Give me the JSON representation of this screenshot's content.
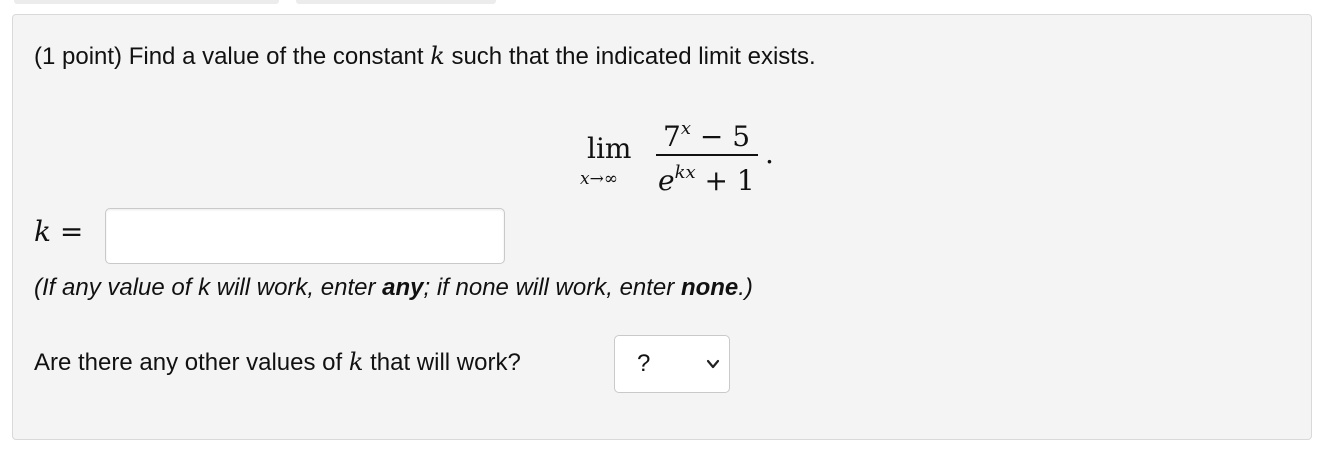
{
  "problem": {
    "intro_prefix": "(1 point) Find a value of the constant ",
    "k_var": "k",
    "intro_suffix": " such that the indicated limit exists.",
    "formula": {
      "lim": "lim",
      "lim_sub": "x→∞",
      "num_base": "7",
      "num_exp": "x",
      "num_rest": " − 5",
      "den_base": "e",
      "den_exp": "kx",
      "den_rest": " + 1",
      "period": "."
    },
    "answer_label_var": "k",
    "answer_label_eq": " =",
    "answer_value": "",
    "answer_placeholder": "",
    "hint": {
      "part1": "(If any value of k will work, enter ",
      "any": "any",
      "part2": "; if none will work, enter ",
      "none": "none",
      "part3": ".)"
    },
    "question_prefix": "Are there any other values of ",
    "question_var": "k",
    "question_suffix": " that will work?",
    "select_value": "?"
  }
}
